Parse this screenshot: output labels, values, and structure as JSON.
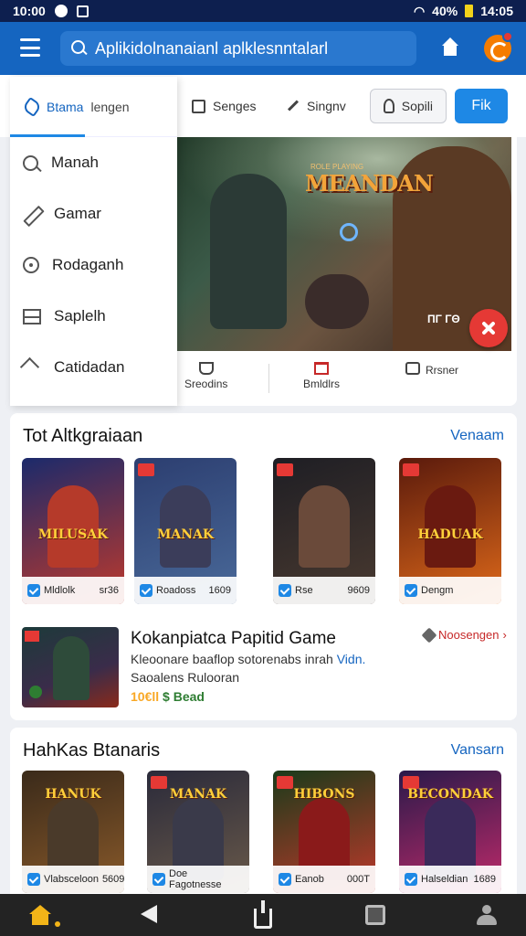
{
  "status_bar": {
    "time_left": "10:00",
    "signal": "40%",
    "time_right": "14:05"
  },
  "app_bar": {
    "search_placeholder": "Aplikidolnanaianl aplklesnntalarl"
  },
  "drawer": {
    "header_primary": "Btama",
    "header_secondary": "lengen",
    "items": [
      {
        "label": "Manah",
        "icon": "wrench-icon"
      },
      {
        "label": "Gamar",
        "icon": "pencil-icon"
      },
      {
        "label": "Rodaganh",
        "icon": "disc-icon"
      },
      {
        "label": "Saplelh",
        "icon": "box-icon"
      },
      {
        "label": "Catidadan",
        "icon": "house-icon"
      }
    ]
  },
  "filters": {
    "chip1": "Senges",
    "chip2": "Singnv",
    "chip3": "Sopili",
    "chip4": "Fik"
  },
  "hero": {
    "title": "MEANDAN",
    "subtitle": "ROLE PLAYING",
    "tag": "ΠΓ ΓΘ",
    "actions": [
      "Sreodins",
      "Bmldlrs",
      "Rrsner"
    ]
  },
  "section1": {
    "title": "Tot Altkgraiaan",
    "link": "Venaam",
    "tiles": [
      {
        "art_title": "MILUSAK",
        "caption": "Mldlolk",
        "number": "sr36",
        "color1": "#1b2a6b",
        "color2": "#c0392b",
        "fig": "#b53a2a"
      },
      {
        "art_title": "MANAK",
        "caption": "Roadoss",
        "number": "1609",
        "color1": "#2c3e70",
        "color2": "#4a6a9a",
        "fig": "#3b3d5a"
      },
      {
        "art_title": "",
        "caption": "Rse",
        "number": "9609",
        "color1": "#1e1e24",
        "color2": "#4a3a30",
        "fig": "#6a4a3a"
      },
      {
        "art_title": "HADUAK",
        "caption": "Dengm",
        "number": "",
        "color1": "#5a1a0c",
        "color2": "#e06a1a",
        "fig": "#6a1a10"
      }
    ]
  },
  "promo": {
    "title": "Kokanpiatca Papitid Game",
    "line1": "Kleoonare baaflop sotorenabs inrah",
    "line1_accent": "Vidn.",
    "line2": "Saoalens Rulooran",
    "price": "10€ll",
    "price_accent": "$ Bead",
    "link": "Noosengen"
  },
  "section2": {
    "title": "HahKas Btanaris",
    "link": "Vansarn",
    "tiles": [
      {
        "art_title": "HANUK",
        "caption": "Vlabsceloon",
        "number": "5609",
        "color1": "#3a2a1a",
        "color2": "#8a5a2a",
        "fig": "#4a3a2a"
      },
      {
        "art_title": "MANAK",
        "caption": "Doe Fagotnesse",
        "number": "",
        "color1": "#2a2a3a",
        "color2": "#6a5a4a",
        "fig": "#3a3a4a"
      },
      {
        "art_title": "HIBONS",
        "caption": "Eanob",
        "number": "000T",
        "color1": "#1a3a1a",
        "color2": "#c0392b",
        "fig": "#8a1a1a"
      },
      {
        "art_title": "BECONDAK",
        "caption": "Halseldian",
        "number": "1689",
        "color1": "#2a1a4a",
        "color2": "#c02a6a",
        "fig": "#3a2a5a"
      }
    ]
  }
}
